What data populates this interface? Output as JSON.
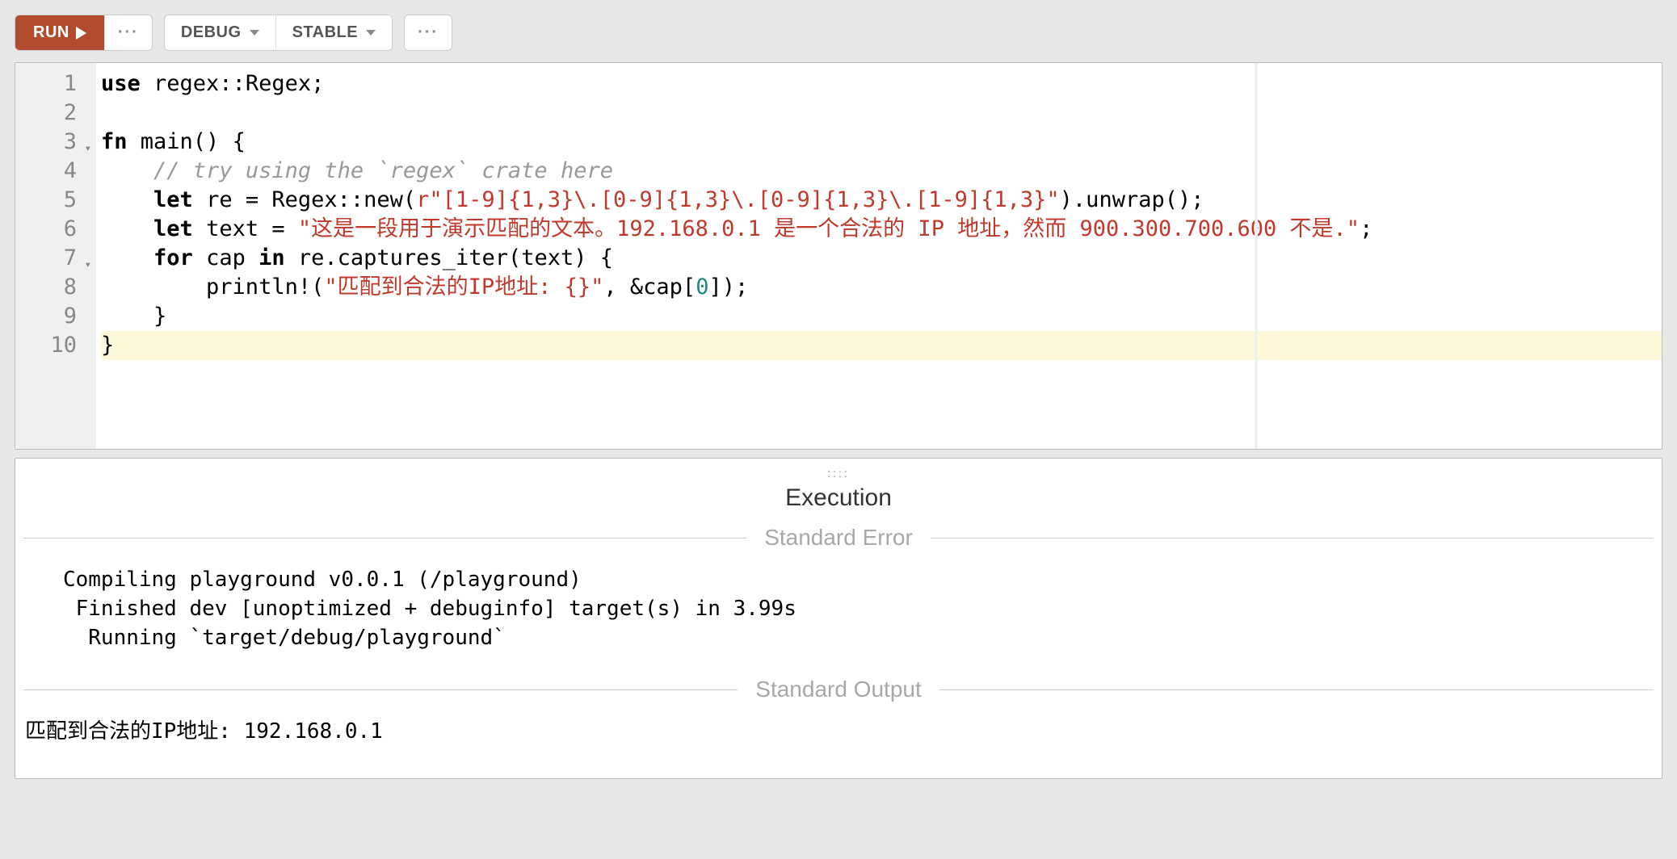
{
  "toolbar": {
    "run_label": "RUN",
    "debug_label": "DEBUG",
    "stable_label": "STABLE"
  },
  "editor": {
    "gutter": [
      "1",
      "2",
      "3",
      "4",
      "5",
      "6",
      "7",
      "8",
      "9",
      "10"
    ],
    "fold_lines": [
      3,
      7
    ],
    "highlight_line": 10,
    "code_tokens": [
      [
        {
          "t": "use ",
          "c": "kw"
        },
        {
          "t": "regex::Regex;"
        }
      ],
      [],
      [
        {
          "t": "fn ",
          "c": "kw"
        },
        {
          "t": "main() {"
        }
      ],
      [
        {
          "t": "    "
        },
        {
          "t": "// try using the `regex` crate here",
          "c": "cm"
        }
      ],
      [
        {
          "t": "    "
        },
        {
          "t": "let ",
          "c": "kw"
        },
        {
          "t": "re = Regex::new("
        },
        {
          "t": "r\"[1-9]{1,3}\\.[0-9]{1,3}\\.[0-9]{1,3}\\.[1-9]{1,3}\"",
          "c": "str"
        },
        {
          "t": ").unwrap();"
        }
      ],
      [
        {
          "t": "    "
        },
        {
          "t": "let ",
          "c": "kw"
        },
        {
          "t": "text = "
        },
        {
          "t": "\"这是一段用于演示匹配的文本。192.168.0.1 是一个合法的 IP 地址，然而 900.300.700.600 不是.\"",
          "c": "str"
        },
        {
          "t": ";"
        }
      ],
      [
        {
          "t": "    "
        },
        {
          "t": "for ",
          "c": "kw"
        },
        {
          "t": "cap "
        },
        {
          "t": "in ",
          "c": "kw"
        },
        {
          "t": "re.captures_iter(text) {"
        }
      ],
      [
        {
          "t": "        println!("
        },
        {
          "t": "\"匹配到合法的IP地址: {}\"",
          "c": "str"
        },
        {
          "t": ", &cap["
        },
        {
          "t": "0",
          "c": "num"
        },
        {
          "t": "]);"
        }
      ],
      [
        {
          "t": "    }"
        }
      ],
      [
        {
          "t": "}"
        }
      ]
    ]
  },
  "output": {
    "title": "Execution",
    "stderr_label": "Standard Error",
    "stderr_text": "   Compiling playground v0.0.1 (/playground)\n    Finished dev [unoptimized + debuginfo] target(s) in 3.99s\n     Running `target/debug/playground`",
    "stdout_label": "Standard Output",
    "stdout_text": "匹配到合法的IP地址: 192.168.0.1"
  }
}
